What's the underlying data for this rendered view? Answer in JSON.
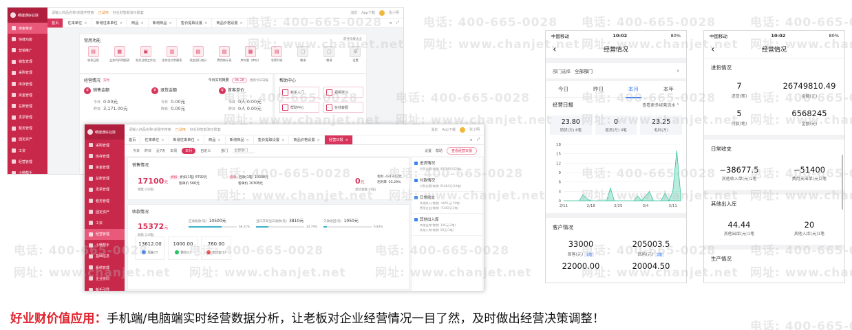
{
  "watermark": {
    "phone": "电话: 400-665-0028",
    "site": "网址: www.chanjet.net"
  },
  "caption": {
    "highlight": "好业财价值应用：",
    "text": "手机端/电脑端实时经营数据分析，让老板对企业经营情况一目了然，及时做出经营决策调整！"
  },
  "desktop_back": {
    "brand": "畅捷通好业财",
    "search_placeholder": "请输入商品名称/关键字搜索",
    "trial": "已试用",
    "trial_note": "好业财智能演示账套",
    "topbar_right": [
      "消息",
      "App下载",
      "张小明"
    ],
    "sidebar": [
      "搜索菜单",
      "快捷功能",
      "营销推广",
      "销售管理",
      "采购管理",
      "库存管理",
      "资金管理",
      "总账管理",
      "发票管理",
      "税务管理",
      "固定资产",
      "工资",
      "经营管理",
      "小畅帮手"
    ],
    "tabs": [
      "首页",
      "往来单位",
      "新增往来单位",
      "商品",
      "新增商品",
      "售价提取设置",
      "商品价格设置"
    ],
    "common_title": "常用功能",
    "common_link": "前往功能大全",
    "functions": [
      "收款日报",
      "业务利润明细表",
      "批次过期工作台",
      "往收往付余额表",
      "现金银行统计",
      "费用统计表",
      "库存量（库存）",
      "发票列表",
      "敬请",
      "敬请",
      "设置"
    ],
    "ops_title": "经营情况",
    "ops_tag": "实时",
    "today_title": "今日实时概要",
    "today_time": "06:28",
    "today_link": "更新今日日报",
    "metrics": [
      {
        "name": "销售金额",
        "l1": "今日",
        "v1": "0.00元",
        "l2": "昨日",
        "v2": "3,171.00元"
      },
      {
        "name": "退货金额",
        "l1": "今日",
        "v1": "0.00元",
        "l2": "昨日",
        "v2": "0.00元"
      },
      {
        "name": "首客单价",
        "l1": "今日",
        "v1": "0人 0.00元",
        "l2": "昨日",
        "v2": "0人 0.00元"
      }
    ],
    "help_title": "帮助中心",
    "help_items": [
      "新手入门",
      "视频学习",
      "帮助中心",
      "在线客服"
    ],
    "ops_footer": "经营"
  },
  "desktop_front": {
    "sidebar": [
      "采购管理",
      "库存管理",
      "资金管理",
      "总账管理",
      "发票管理",
      "税务管理",
      "固定资产",
      "工资",
      "经营管理",
      "小畅帮手",
      "基础信息",
      "系统管理",
      "企业协同",
      "新手引导"
    ],
    "tabs": [
      "首页",
      "往来单位",
      "新增往来单位",
      "商品",
      "新增商品",
      "售价提取设置",
      "商品价格设置",
      "经营日报"
    ],
    "filters": [
      "今日",
      "昨日",
      "近7天",
      "本周",
      "本月",
      "自定义"
    ],
    "filter_dept": "部门",
    "filter_dept_value": "全部部门",
    "filter_right": [
      "设置",
      "帮助"
    ],
    "filter_link": "查看经营日报",
    "sales_title": "销售情况",
    "sales_value": "17100",
    "sales_unit": "元",
    "sales_sub": "销售 (26笔)",
    "sales_b1_tag": "折扣",
    "sales_b1_lines": [
      "折扣(1笔)  6792元",
      "客单价  566元"
    ],
    "sales_b2_tag": "客单",
    "sales_b2_lines": [
      "回款(1笔)  10308元",
      "客单价  10308元"
    ],
    "sales_right_value": "0",
    "sales_right_unit": "元",
    "sales_right_sub": "退货金额 (0笔)",
    "sales_right_lines": [
      "毛利  -4313.07元",
      "毛利率  -25.29%"
    ],
    "receipt_title": "收款情况",
    "receipt_value": "15372",
    "receipt_unit": "元",
    "receipt_sub": "收款 (10笔)",
    "receipt_bars": [
      {
        "label": "应收账款(笔)",
        "value": "10500元",
        "pct": "68.31%",
        "fill": 0.68
      },
      {
        "label": "当日开单当日收款(笔)",
        "value": "3810元",
        "pct": "24.79%",
        "fill": 0.25
      },
      {
        "label": "欠款收回(笔)",
        "value": "1050元",
        "pct": "6.83%",
        "fill": 0.07
      }
    ],
    "tiles": [
      {
        "value": "13612.00",
        "label": "现金(7)",
        "color": "#3b82f6"
      },
      {
        "value": "1000.00",
        "label": "微信(1)",
        "color": "#22c55e"
      },
      {
        "value": "760.00",
        "label": "支付宝(1)",
        "color": "#ef4444"
      }
    ],
    "right_panel": [
      {
        "title": "进货情况",
        "sub": "进货金额(笔数)  49798元(22笔)"
      },
      {
        "title": "付款情况",
        "sub": "付款金额(笔数)  61064元(14笔)"
      },
      {
        "title": "日常收支",
        "sub": "其他收入(笔数)  -9851元(16笔)",
        "sub2": "费用支出(笔数)  -5140元(2笔)"
      },
      {
        "title": "其他出入库",
        "sub": "其他出库(笔数)  346元(2笔)",
        "sub2": "其他入库(笔数)  20元(1笔)"
      }
    ]
  },
  "phone1": {
    "carrier": "中国移动",
    "time": "10:02",
    "battery": "80%",
    "title": "经营情况",
    "dept_label": "部门选择",
    "dept_value": "全部部门",
    "periods": [
      "今日",
      "昨日",
      "本月",
      "本年"
    ],
    "active_period": 2,
    "daily_title": "经营日报",
    "daily_link": "查看更多经营流水",
    "stats": [
      {
        "value": "23.80",
        "label": "销货(万) 8笔"
      },
      {
        "value": "0",
        "label": "退货(万) 0笔"
      },
      {
        "value": "23.25",
        "label": "毛利(万)"
      }
    ],
    "customer_title": "客户情况",
    "customer": [
      {
        "value": "33000",
        "label": "首客(元)",
        "tag": "1笔"
      },
      {
        "value": "205003.5",
        "label": "回购(元)",
        "tag": "3笔"
      }
    ],
    "next_row": [
      "22000.00",
      "20004.50"
    ]
  },
  "chart_data": {
    "type": "area",
    "x": [
      "2/11",
      "2/18",
      "2/25",
      "3/4",
      "3/11"
    ],
    "ylim": [
      0,
      18
    ],
    "yticks": [
      0,
      3,
      6,
      9,
      12,
      15,
      18
    ],
    "grid": true,
    "points": [
      [
        0,
        0
      ],
      [
        4,
        0
      ],
      [
        5,
        2
      ],
      [
        6,
        0.5
      ],
      [
        7,
        0
      ],
      [
        11,
        0
      ],
      [
        12,
        4
      ],
      [
        13,
        0
      ],
      [
        18,
        0
      ],
      [
        19,
        1.5
      ],
      [
        20,
        0
      ],
      [
        22,
        3
      ],
      [
        23,
        0
      ],
      [
        25,
        0
      ],
      [
        26,
        2.5
      ],
      [
        27,
        0
      ],
      [
        28,
        3
      ],
      [
        29,
        16
      ],
      [
        30,
        2
      ]
    ]
  },
  "phone2": {
    "carrier": "中国移动",
    "time": "10:02",
    "battery": "80%",
    "title": "经营情况",
    "purchase_title": "进货情况",
    "purchase": [
      {
        "value": "7",
        "label": "进货(笔)"
      },
      {
        "value": "26749810.49",
        "label": "金额(元)"
      },
      {
        "value": "5",
        "label": "付款(笔)"
      },
      {
        "value": "6568245",
        "label": "金额(元)"
      }
    ],
    "daily_title": "日常收支",
    "daily": [
      {
        "value": "−38677.5",
        "label": "其他收入单(元)1笔"
      },
      {
        "value": "−51400",
        "label": "费用支出单(元)2笔"
      }
    ],
    "other_title": "其他出入库",
    "other": [
      {
        "value": "44.44",
        "label": "其他出库(元)1笔"
      },
      {
        "value": "20",
        "label": "其他入库(元)1笔"
      }
    ],
    "prod_title": "生产情况"
  }
}
